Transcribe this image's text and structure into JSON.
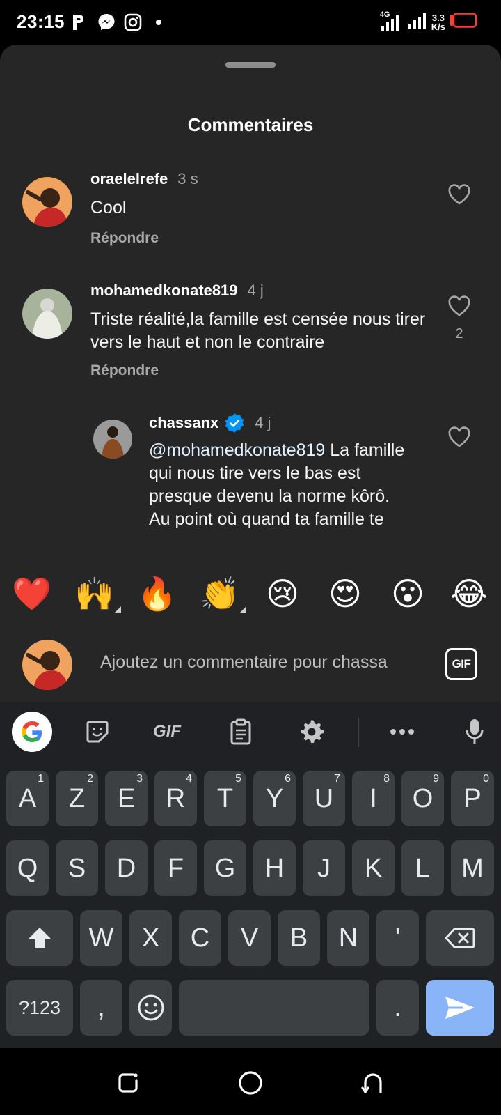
{
  "status_bar": {
    "time": "23:15",
    "network": "4G",
    "speed_value": "3.3",
    "speed_unit": "K/s",
    "battery_color": "#ff3b30"
  },
  "sheet": {
    "title": "Commentaires"
  },
  "comments": [
    {
      "username": "oraelelrefe",
      "time": "3 s",
      "text": "Cool",
      "reply_label": "Répondre",
      "likes": ""
    },
    {
      "username": "mohamedkonate819",
      "time": "4 j",
      "text": "Triste réalité,la famille est censée nous tirer vers le haut et non le contraire",
      "reply_label": "Répondre",
      "likes": "2"
    },
    {
      "username": "chassanx",
      "verified": true,
      "time": "4 j",
      "mention": "@mohamedkonate819",
      "text": " La famille qui nous tire vers le bas est presque devenu la norme kôrô.",
      "text2": "Au point où quand ta famille te",
      "likes": ""
    }
  ],
  "emoji_bar": {
    "items": [
      {
        "name": "heart-emoji",
        "glyph": "❤️",
        "variants": false
      },
      {
        "name": "raised-hands-emoji",
        "glyph": "🙌",
        "variants": true
      },
      {
        "name": "fire-emoji",
        "glyph": "🔥",
        "variants": false
      },
      {
        "name": "clapping-emoji",
        "glyph": "👏",
        "variants": true
      },
      {
        "name": "crying-emoji",
        "glyph": "😢",
        "variants": false
      },
      {
        "name": "heart-eyes-emoji",
        "glyph": "😍",
        "variants": false
      },
      {
        "name": "surprised-emoji",
        "glyph": "😮",
        "variants": false
      },
      {
        "name": "laughing-emoji",
        "glyph": "😂",
        "variants": false
      }
    ]
  },
  "input": {
    "placeholder": "Ajoutez un commentaire pour chassa",
    "gif_label": "GIF"
  },
  "keyboard": {
    "toolbar_gif": "GIF",
    "row1": [
      {
        "k": "A",
        "h": "1"
      },
      {
        "k": "Z",
        "h": "2"
      },
      {
        "k": "E",
        "h": "3"
      },
      {
        "k": "R",
        "h": "4"
      },
      {
        "k": "T",
        "h": "5"
      },
      {
        "k": "Y",
        "h": "6"
      },
      {
        "k": "U",
        "h": "7"
      },
      {
        "k": "I",
        "h": "8"
      },
      {
        "k": "O",
        "h": "9"
      },
      {
        "k": "P",
        "h": "0"
      }
    ],
    "row2": [
      "Q",
      "S",
      "D",
      "F",
      "G",
      "H",
      "J",
      "K",
      "L",
      "M"
    ],
    "row3": [
      "W",
      "X",
      "C",
      "V",
      "B",
      "N",
      "'"
    ],
    "symbols_label": "?123",
    "comma": ",",
    "period": ".",
    "colors": {
      "key": "#3c4043",
      "send": "#8ab4f8",
      "background": "#202124"
    }
  }
}
